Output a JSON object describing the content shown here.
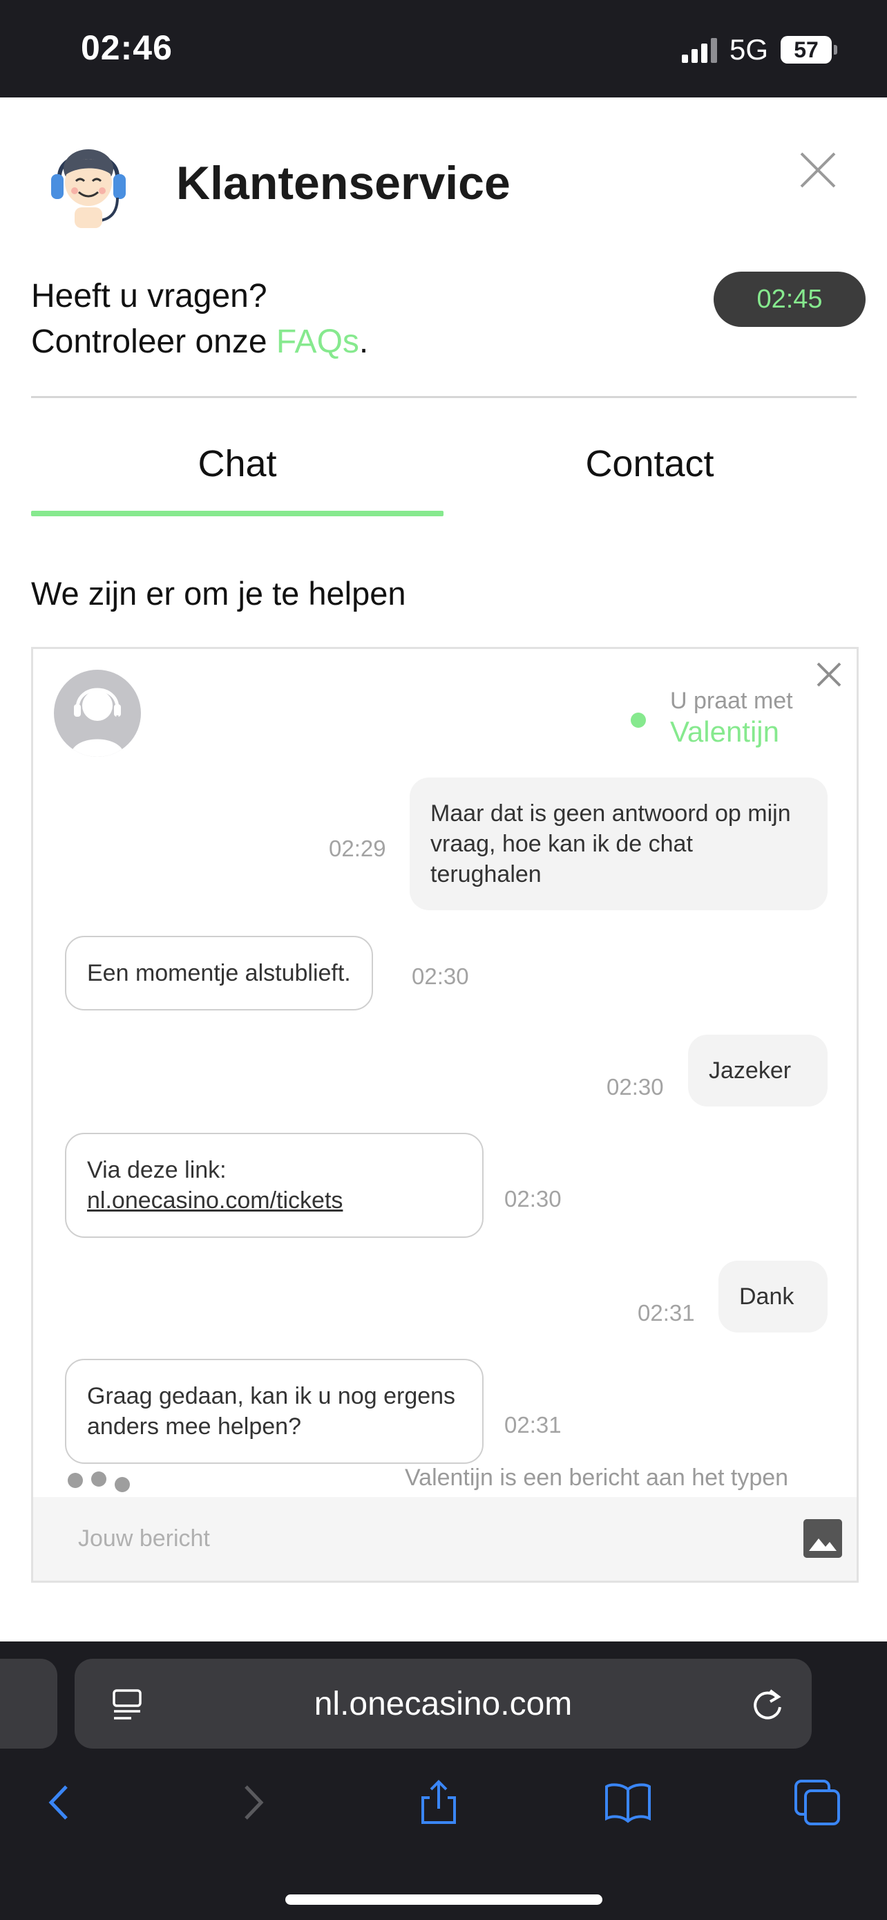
{
  "status_bar": {
    "time": "02:46",
    "network": "5G",
    "battery": "57"
  },
  "header": {
    "title": "Klantenservice"
  },
  "faq": {
    "line1": "Heeft u vragen?",
    "line2_prefix": "Controleer onze ",
    "link": "FAQs",
    "suffix": "."
  },
  "time_badge": "02:45",
  "tabs": [
    {
      "label": "Chat",
      "active": true
    },
    {
      "label": "Contact",
      "active": false
    }
  ],
  "help_heading": "We zijn er om je te helpen",
  "chat": {
    "talking_label": "U praat met",
    "agent_name": "Valentijn",
    "messages": [
      {
        "from": "user",
        "time": "02:29",
        "text": "Maar dat is geen antwoord op mijn vraag, hoe kan ik de chat terughalen"
      },
      {
        "from": "agent",
        "time": "02:30",
        "text": "Een momentje alstublieft."
      },
      {
        "from": "user",
        "time": "02:30",
        "text": "Jazeker"
      },
      {
        "from": "agent",
        "time": "02:30",
        "text": "Via deze link:",
        "link": "nl.onecasino.com/tickets"
      },
      {
        "from": "user",
        "time": "02:31",
        "text": "Dank"
      },
      {
        "from": "agent",
        "time": "02:31",
        "text": "Graag gedaan, kan ik u nog ergens anders mee helpen?"
      }
    ],
    "typing_text": "Valentijn is een bericht aan het typen",
    "input_placeholder": "Jouw bericht"
  },
  "browser": {
    "url": "nl.onecasino.com"
  },
  "colors": {
    "accent": "#86e98e",
    "dark": "#1c1c21",
    "ios_blue": "#3a86f7"
  }
}
